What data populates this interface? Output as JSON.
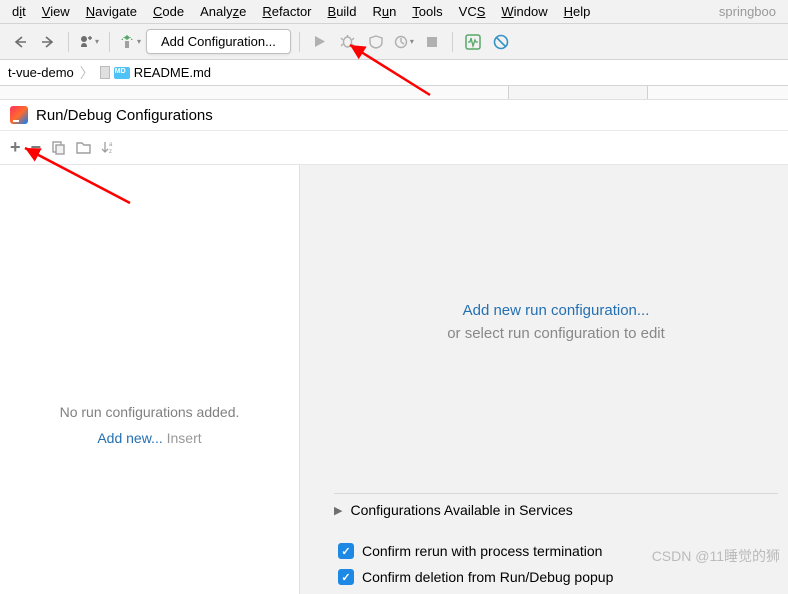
{
  "menubar": {
    "items": [
      "dit",
      "View",
      "Navigate",
      "Code",
      "Analyze",
      "Refactor",
      "Build",
      "Run",
      "Tools",
      "VCS",
      "Window",
      "Help"
    ],
    "project": "springboo"
  },
  "toolbar": {
    "config_label": "Add Configuration..."
  },
  "breadcrumb": {
    "project": "t-vue-demo",
    "file": "README.md"
  },
  "dialog": {
    "title": "Run/Debug Configurations",
    "left": {
      "empty_msg": "No run configurations added.",
      "add_link": "Add new...",
      "insert_hint": "Insert"
    },
    "right": {
      "add_link": "Add new run configuration...",
      "or_text": "or select run configuration to edit",
      "section": "Configurations Available in Services",
      "check1": "Confirm rerun with process termination",
      "check2": "Confirm deletion from Run/Debug popup"
    }
  },
  "watermark": "CSDN @11睡觉的狮"
}
